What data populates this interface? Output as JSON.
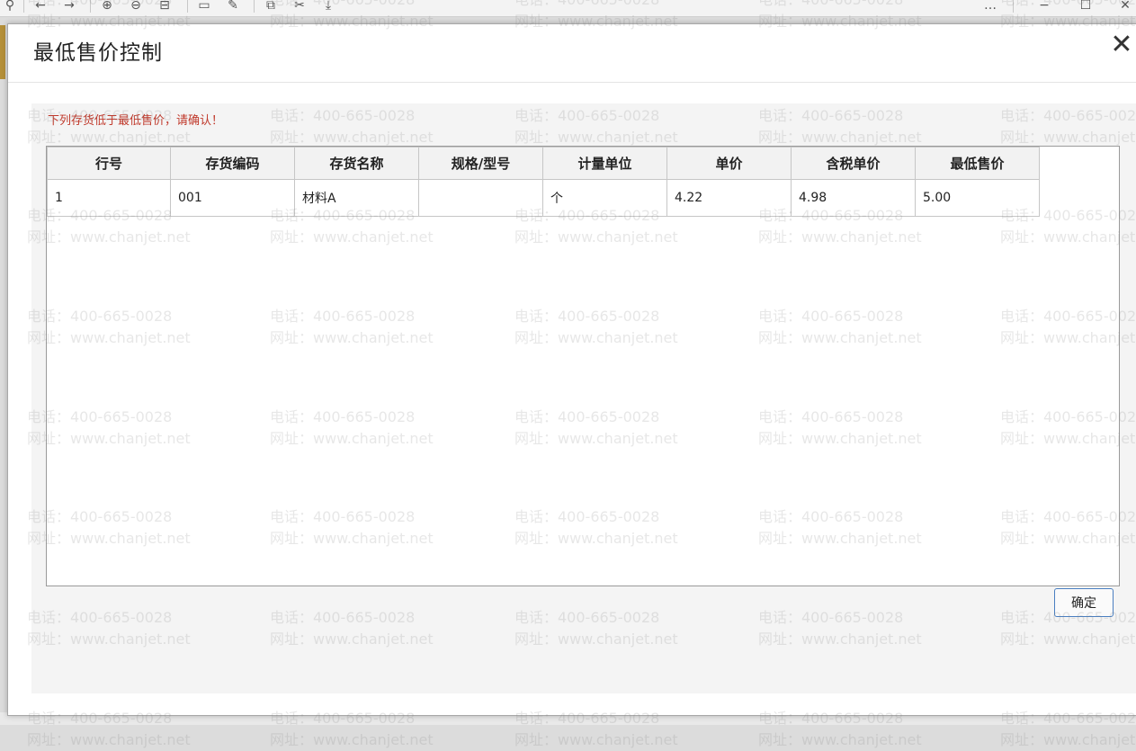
{
  "toolbar": {
    "icons": [
      "pin-icon",
      "back-arrow-icon",
      "forward-arrow-icon",
      "zoom-in-icon",
      "zoom-out-icon",
      "fit-page-icon",
      "frame-icon",
      "edit-icon",
      "copy-icon",
      "scissors-icon",
      "download-icon",
      "more-icon",
      "minimize-icon",
      "maximize-icon",
      "close-icon"
    ],
    "glyphs": {
      "pin": "⚲",
      "back": "←",
      "forward": "→",
      "zoom_in": "⊕",
      "zoom_out": "⊖",
      "fit": "⊟",
      "frame": "▭",
      "edit": "✎",
      "copy": "⧉",
      "scissors": "✂",
      "download": "⤓",
      "more": "…",
      "minimize": "−",
      "maximize": "☐",
      "close": "✕"
    }
  },
  "dialog": {
    "title": "最低售价控制",
    "close_glyph": "✕",
    "warning": "下列存货低于最低售价，请确认！",
    "ok_label": "确定",
    "warning_color": "#c0392b",
    "ok_border_color": "#4a7fc1"
  },
  "table": {
    "columns": [
      "行号",
      "存货编码",
      "存货名称",
      "规格/型号",
      "计量单位",
      "单价",
      "含税单价",
      "最低售价"
    ],
    "rows": [
      [
        "1",
        "001",
        "材料A",
        "",
        "个",
        "4.22",
        "4.98",
        "5.00"
      ]
    ]
  },
  "watermark": {
    "phone": "电话：400-665-0028",
    "site": "网址：www.chanjet.net"
  }
}
